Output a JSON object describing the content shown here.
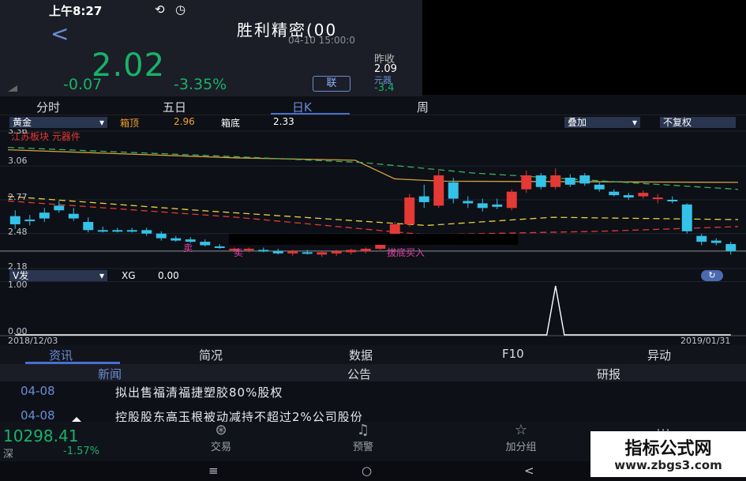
{
  "status_bar": {
    "time": "上午8:27"
  },
  "header": {
    "back_label": "<",
    "stock_name": "胜利精密(00",
    "timestamp": "04-10 15:00:0",
    "price": "2.02",
    "change": "-0.07",
    "change_pct": "-3.35%",
    "link_button": "联",
    "prev_close_label": "昨收",
    "prev_close": "2.09",
    "sub_label": "元器",
    "sub_value": "-3.4"
  },
  "tabs": [
    "分时",
    "五日",
    "日K",
    "周"
  ],
  "toolbar": {
    "indicator_select": "黄金",
    "box_top_label": "箱顶",
    "box_top_value": "2.96",
    "box_bottom_label": "箱底",
    "box_bottom_value": "2.33",
    "overlay_select": "叠加",
    "adjust_select": "不复权",
    "legend_text": "江苏板块  元器件"
  },
  "main_chart": {
    "y_ticks": [
      "3.36",
      "3.06",
      "2.77",
      "2.48",
      "2.18"
    ],
    "buy_sell_labels": [
      "卖",
      "卖",
      "拔底买入"
    ]
  },
  "volume_panel": {
    "indicator_select": "V发",
    "xg_label": "XG",
    "xg_value": "0.00",
    "y_ticks": [
      "1.00",
      "0.00"
    ]
  },
  "date_axis": {
    "start": "2018/12/03",
    "end": "2019/01/31"
  },
  "bottom_tabs": [
    "资讯",
    "简况",
    "数据",
    "F10",
    "异动"
  ],
  "sub_tabs": [
    "新闻",
    "公告",
    "研报"
  ],
  "news": [
    {
      "date": "04-08",
      "title": "拟出售福清福捷塑胶80%股权"
    },
    {
      "date": "04-08",
      "title": "控股股东高玉根被动减持不超过2%公司股份"
    }
  ],
  "bottom_nav": {
    "index_value": "10298.41",
    "index_name": "深",
    "index_change": "-1.57%",
    "items": [
      "交易",
      "预警",
      "加分组",
      "更多"
    ]
  },
  "system_nav": {
    "menu": "≡",
    "home": "○",
    "back": "<"
  },
  "watermark": {
    "name": "指标公式网",
    "url": "www.zbgs3.com"
  },
  "colors": {
    "up": "#e53935",
    "down": "#18b26b",
    "accent": "#6c8cd5",
    "cyan": "#35c2e8"
  },
  "chart_data": [
    {
      "type": "candlestick",
      "title": "",
      "x_range": [
        "2018/12/03",
        "2019/01/31"
      ],
      "ylim": [
        2.18,
        3.36
      ],
      "box_top": 2.96,
      "box_bottom": 2.33,
      "candles": [
        {
          "o": 2.63,
          "h": 2.68,
          "l": 2.52,
          "c": 2.56
        },
        {
          "o": 2.6,
          "h": 2.64,
          "l": 2.55,
          "c": 2.59
        },
        {
          "o": 2.66,
          "h": 2.7,
          "l": 2.58,
          "c": 2.61
        },
        {
          "o": 2.72,
          "h": 2.76,
          "l": 2.66,
          "c": 2.68
        },
        {
          "o": 2.65,
          "h": 2.7,
          "l": 2.59,
          "c": 2.61
        },
        {
          "o": 2.58,
          "h": 2.62,
          "l": 2.49,
          "c": 2.51
        },
        {
          "o": 2.51,
          "h": 2.54,
          "l": 2.49,
          "c": 2.5
        },
        {
          "o": 2.51,
          "h": 2.53,
          "l": 2.49,
          "c": 2.5
        },
        {
          "o": 2.51,
          "h": 2.53,
          "l": 2.49,
          "c": 2.5
        },
        {
          "o": 2.51,
          "h": 2.53,
          "l": 2.46,
          "c": 2.48
        },
        {
          "o": 2.48,
          "h": 2.5,
          "l": 2.42,
          "c": 2.44
        },
        {
          "o": 2.44,
          "h": 2.46,
          "l": 2.41,
          "c": 2.42
        },
        {
          "o": 2.43,
          "h": 2.45,
          "l": 2.4,
          "c": 2.41
        },
        {
          "o": 2.41,
          "h": 2.43,
          "l": 2.37,
          "c": 2.38
        },
        {
          "o": 2.37,
          "h": 2.39,
          "l": 2.35,
          "c": 2.36
        },
        {
          "o": 2.34,
          "h": 2.36,
          "l": 2.32,
          "c": 2.35
        },
        {
          "o": 2.34,
          "h": 2.36,
          "l": 2.32,
          "c": 2.35
        },
        {
          "o": 2.34,
          "h": 2.36,
          "l": 2.32,
          "c": 2.33
        },
        {
          "o": 2.33,
          "h": 2.35,
          "l": 2.3,
          "c": 2.31
        },
        {
          "o": 2.31,
          "h": 2.34,
          "l": 2.29,
          "c": 2.33
        },
        {
          "o": 2.32,
          "h": 2.34,
          "l": 2.3,
          "c": 2.31
        },
        {
          "o": 2.3,
          "h": 2.33,
          "l": 2.28,
          "c": 2.32
        },
        {
          "o": 2.31,
          "h": 2.34,
          "l": 2.29,
          "c": 2.33
        },
        {
          "o": 2.32,
          "h": 2.35,
          "l": 2.3,
          "c": 2.34
        },
        {
          "o": 2.33,
          "h": 2.36,
          "l": 2.31,
          "c": 2.35
        },
        {
          "o": 2.35,
          "h": 2.45,
          "l": 2.34,
          "c": 2.44
        },
        {
          "o": 2.46,
          "h": 2.58,
          "l": 2.45,
          "c": 2.56
        },
        {
          "o": 2.56,
          "h": 2.82,
          "l": 2.54,
          "c": 2.79
        },
        {
          "o": 2.8,
          "h": 2.9,
          "l": 2.7,
          "c": 2.75
        },
        {
          "o": 2.72,
          "h": 3.02,
          "l": 2.7,
          "c": 2.98
        },
        {
          "o": 2.92,
          "h": 2.96,
          "l": 2.74,
          "c": 2.78
        },
        {
          "o": 2.76,
          "h": 2.8,
          "l": 2.7,
          "c": 2.74
        },
        {
          "o": 2.74,
          "h": 2.78,
          "l": 2.67,
          "c": 2.7
        },
        {
          "o": 2.73,
          "h": 2.78,
          "l": 2.69,
          "c": 2.71
        },
        {
          "o": 2.7,
          "h": 2.86,
          "l": 2.68,
          "c": 2.84
        },
        {
          "o": 2.86,
          "h": 3.02,
          "l": 2.83,
          "c": 2.98
        },
        {
          "o": 2.98,
          "h": 3.0,
          "l": 2.86,
          "c": 2.88
        },
        {
          "o": 2.88,
          "h": 3.04,
          "l": 2.86,
          "c": 2.98
        },
        {
          "o": 2.96,
          "h": 2.99,
          "l": 2.88,
          "c": 2.9
        },
        {
          "o": 2.98,
          "h": 3.0,
          "l": 2.89,
          "c": 2.91
        },
        {
          "o": 2.9,
          "h": 2.92,
          "l": 2.84,
          "c": 2.86
        },
        {
          "o": 2.84,
          "h": 2.86,
          "l": 2.8,
          "c": 2.81
        },
        {
          "o": 2.81,
          "h": 2.83,
          "l": 2.77,
          "c": 2.79
        },
        {
          "o": 2.8,
          "h": 2.85,
          "l": 2.78,
          "c": 2.83
        },
        {
          "o": 2.78,
          "h": 2.82,
          "l": 2.74,
          "c": 2.79
        },
        {
          "o": 2.77,
          "h": 2.8,
          "l": 2.74,
          "c": 2.76
        },
        {
          "o": 2.73,
          "h": 2.74,
          "l": 2.48,
          "c": 2.5
        },
        {
          "o": 2.46,
          "h": 2.48,
          "l": 2.38,
          "c": 2.41
        },
        {
          "o": 2.42,
          "h": 2.44,
          "l": 2.38,
          "c": 2.4
        },
        {
          "o": 2.39,
          "h": 2.41,
          "l": 2.3,
          "c": 2.33
        }
      ]
    },
    {
      "type": "line",
      "title": "",
      "ylim": [
        0,
        1
      ],
      "series": [
        {
          "values": [
            0,
            0,
            0,
            0,
            0,
            0,
            0,
            0,
            0,
            0,
            0,
            0,
            0,
            0,
            0,
            0,
            0,
            0,
            0,
            0,
            0,
            0,
            0,
            0,
            0,
            0,
            0,
            0,
            0,
            0,
            0,
            0,
            0,
            0,
            0,
            0,
            0,
            0,
            0,
            0,
            0,
            0,
            0,
            0,
            0,
            0,
            0,
            0,
            0,
            0
          ]
        }
      ],
      "spike_index": 37
    }
  ]
}
